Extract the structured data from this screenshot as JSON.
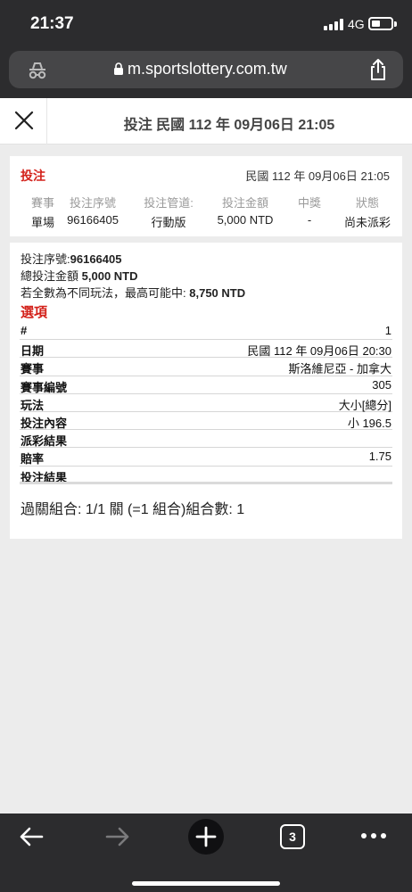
{
  "status": {
    "time": "21:37",
    "network": "4G"
  },
  "browser": {
    "url": "m.sportslottery.com.tw",
    "tab_count": "3"
  },
  "header": {
    "title": "投注 民國 112 年 09月06日 21:05"
  },
  "summary": {
    "label": "投注",
    "datetime": "民國 112 年 09月06日 21:05",
    "columns": [
      {
        "header": "賽事",
        "value": "單場"
      },
      {
        "header": "投注序號",
        "value": "96166405"
      },
      {
        "header": "投注管道:",
        "value": "行動版"
      },
      {
        "header": "投注金額",
        "value": "5,000 NTD"
      },
      {
        "header": "中獎",
        "value": "-"
      },
      {
        "header": "狀態",
        "value": "尚未派彩"
      }
    ]
  },
  "detail": {
    "serial_label": "投注序號:",
    "serial_value": "96166405",
    "total_label": "總投注金額",
    "total_value": "5,000 NTD",
    "max_label": "若全數為不同玩法，最高可能中:",
    "max_value": "8,750 NTD",
    "options_title": "選項",
    "rows": [
      {
        "label": "#",
        "value": "1"
      },
      {
        "label": "日期",
        "value": "民國 112 年 09月06日 20:30"
      },
      {
        "label": "賽事",
        "value": "斯洛維尼亞 - 加拿大"
      },
      {
        "label": "賽事編號",
        "value": "305"
      },
      {
        "label": "玩法",
        "value": "大小[總分]"
      },
      {
        "label": "投注內容",
        "value": "小 196.5"
      },
      {
        "label": "派彩結果",
        "value": ""
      },
      {
        "label": "賠率",
        "value": "1.75"
      },
      {
        "label": "投注結果",
        "value": ""
      }
    ],
    "combo": "過關組合: 1/1 關 (=1 組合)組合數: 1"
  },
  "colors": {
    "accent_red": "#d3211a",
    "chrome": "#2c2c2e"
  },
  "icons": [
    "incognito-icon",
    "lock-icon",
    "share-icon",
    "close-icon",
    "back-arrow-icon",
    "forward-arrow-icon",
    "new-tab-icon",
    "tabs-icon",
    "more-icon"
  ]
}
